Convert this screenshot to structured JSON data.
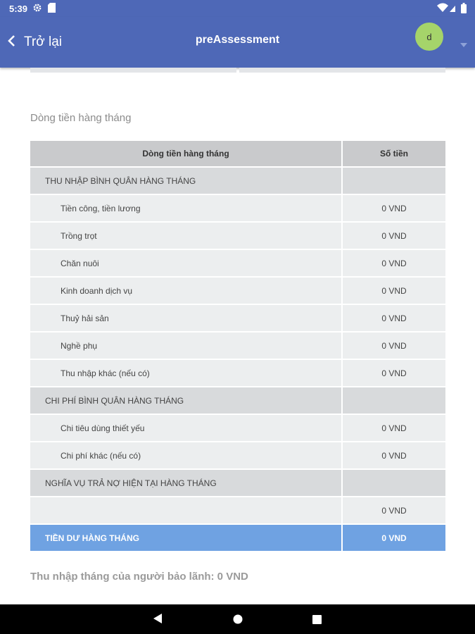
{
  "status_bar": {
    "time": "5:39"
  },
  "app_bar": {
    "back_label": "Trở lại",
    "title": "preAssessment",
    "avatar_initial": "d"
  },
  "section_title": "Dòng tiền hàng tháng",
  "table": {
    "headers": [
      "Dòng tiền hàng tháng",
      "Số tiền"
    ],
    "rows": [
      {
        "type": "group",
        "label": "THU NHẬP BÌNH QUÂN HÀNG THÁNG",
        "amount": ""
      },
      {
        "type": "row",
        "label": "Tiền công, tiền lương",
        "amount": "0 VND"
      },
      {
        "type": "row",
        "label": "Trồng trọt",
        "amount": "0 VND"
      },
      {
        "type": "row",
        "label": "Chăn nuôi",
        "amount": "0 VND"
      },
      {
        "type": "row",
        "label": "Kinh doanh dịch vụ",
        "amount": "0 VND"
      },
      {
        "type": "row",
        "label": "Thuỷ hải sản",
        "amount": "0 VND"
      },
      {
        "type": "row",
        "label": "Nghề phụ",
        "amount": "0 VND"
      },
      {
        "type": "row",
        "label": "Thu nhập khác (nếu có)",
        "amount": "0 VND"
      },
      {
        "type": "group",
        "label": "CHI PHÍ BÌNH QUÂN HÀNG THÁNG",
        "amount": ""
      },
      {
        "type": "row",
        "label": "Chi tiêu dùng thiết yếu",
        "amount": "0 VND"
      },
      {
        "type": "row",
        "label": "Chi phí khác (nếu có)",
        "amount": "0 VND"
      },
      {
        "type": "group",
        "label": "NGHĨA VỤ TRẢ NỢ HIỆN TẠI HÀNG THÁNG",
        "amount": ""
      },
      {
        "type": "row",
        "label": "",
        "amount": "0 VND"
      },
      {
        "type": "total",
        "label": "TIỀN DƯ HÀNG THÁNG",
        "amount": "0 VND"
      }
    ]
  },
  "footer_note": "Thu nhập tháng của người bảo lãnh: 0 VND",
  "icons": {
    "status_left": [
      "gear-icon",
      "sd-card-icon"
    ],
    "status_right": [
      "wifi-icon",
      "battery-icon"
    ],
    "app_bar": [
      "chevron-left-icon",
      "dropdown-arrow-icon"
    ],
    "nav": [
      "back-triangle-icon",
      "home-circle-icon",
      "recents-square-icon"
    ]
  },
  "colors": {
    "app_bar": "#4e68b7",
    "avatar": "#a5d46a",
    "header_row": "#c9cacc",
    "group_row": "#d8dadc",
    "data_row": "#eceeef",
    "total_row": "#6fa2e2"
  }
}
